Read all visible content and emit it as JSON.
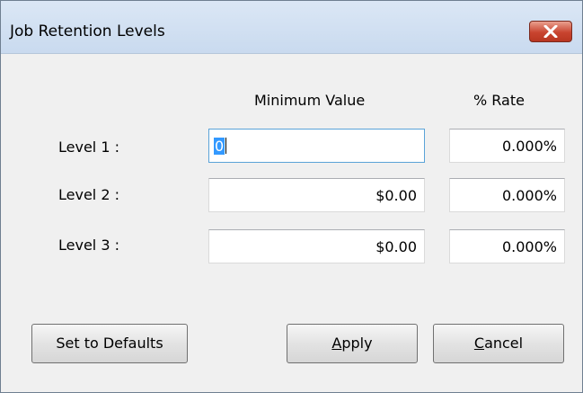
{
  "window": {
    "title": "Job Retention Levels"
  },
  "columns": {
    "minimum_value": "Minimum Value",
    "rate": "% Rate"
  },
  "rows": [
    {
      "label": "Level 1 :",
      "minimum_value": "0",
      "rate": "0.000%"
    },
    {
      "label": "Level 2 :",
      "minimum_value": "$0.00",
      "rate": "0.000%"
    },
    {
      "label": "Level 3 :",
      "minimum_value": "$0.00",
      "rate": "0.000%"
    }
  ],
  "buttons": {
    "set_defaults": "Set to Defaults",
    "apply_mnemonic": "A",
    "apply_rest": "pply",
    "cancel_mnemonic": "C",
    "cancel_rest": "ancel"
  },
  "colors": {
    "selection": "#3399ff",
    "close_button": "#c9442f",
    "focus_border": "#5aa3d8"
  },
  "icons": {
    "close": "close-x-icon"
  }
}
